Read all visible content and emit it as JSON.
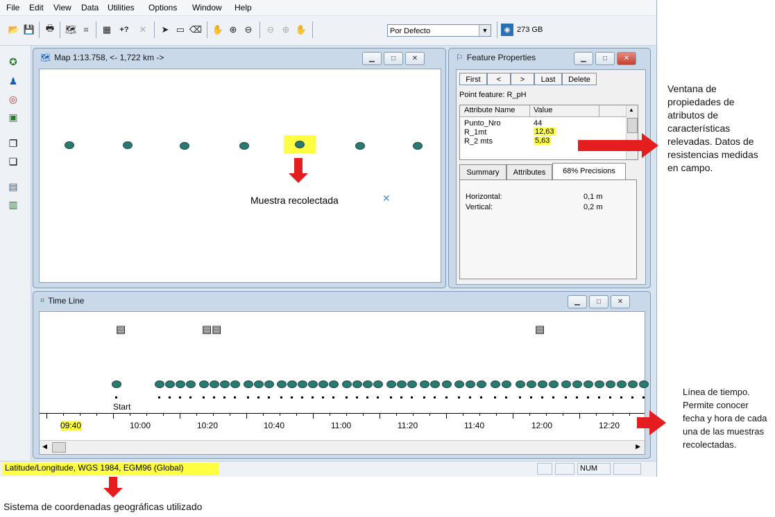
{
  "menu": [
    "File",
    "Edit",
    "View",
    "Data",
    "Utilities",
    "Options",
    "Window",
    "Help"
  ],
  "toolbar": {
    "plus_question": "+?",
    "combo_value": "Por Defecto",
    "disk_space": "273 GB"
  },
  "map_window": {
    "title": "Map 1:13.758, <- 1,722 km ->",
    "caption": "Muestra recolectada"
  },
  "feature_window": {
    "title": "Feature Properties",
    "nav": {
      "first": "First",
      "prev": "<",
      "next": ">",
      "last": "Last",
      "delete": "Delete"
    },
    "feature_label": "Point feature: R_pH",
    "col_attr": "Attribute Name",
    "col_value": "Value",
    "rows": [
      {
        "name": "Punto_Nro",
        "value": "44"
      },
      {
        "name": "R_1mt",
        "value": "12,63"
      },
      {
        "name": "R_2 mts",
        "value": "5,63"
      }
    ],
    "tabs": [
      "Summary",
      "Attributes",
      "68% Precisions"
    ],
    "precision": [
      {
        "label": "Horizontal:",
        "value": "0,1 m"
      },
      {
        "label": "Vertical:",
        "value": "0,2 m"
      }
    ]
  },
  "timeline_window": {
    "title": "Time Line",
    "start_label": "Start",
    "times": [
      "09:40",
      "10:00",
      "10:20",
      "10:40",
      "11:00",
      "11:20",
      "11:40",
      "12:00",
      "12:20"
    ]
  },
  "statusbar": {
    "coords": "Latitude/Longitude, WGS 1984, EGM96 (Global)",
    "num": "NUM"
  },
  "annotations": {
    "feature_note": "Ventana de propiedades de atributos de características relevadas. Datos de resistencias medidas en campo.",
    "timeline_note": "Línea de tiempo. Permite conocer fecha y hora de cada una de las muestras recolectadas.",
    "coords_note": "Sistema de coordenadas geográficas utilizado"
  },
  "colors": {
    "highlight": "#ffff44",
    "arrow": "#e41e1e",
    "point": "#2b7a72"
  }
}
